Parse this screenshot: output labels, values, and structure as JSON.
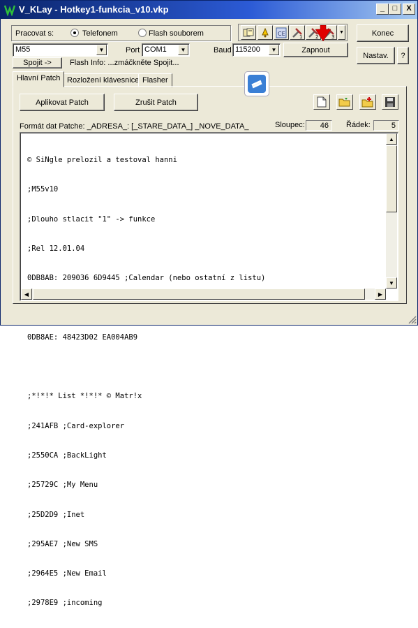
{
  "window": {
    "title": "V_KLay - Hotkey1-funkcia_v10.vkp",
    "minimize": "_",
    "maximize": "□",
    "close": "X"
  },
  "connection": {
    "pracovat_label": "Pracovat s:",
    "radio_phone": "Telefonem",
    "radio_flash": "Flash souborem",
    "radio_selected": "Telefonem",
    "model_value": "M55",
    "port_label": "Port",
    "port_value": "COM1",
    "baud_label": "Baud",
    "baud_value": "115200",
    "spojit_button": "Spojit ->",
    "flash_info": "Flash Info: ...zmáčkněte Spojit...",
    "zapnout_button": "Zapnout"
  },
  "toolbar_icons": [
    "phone-book-icon",
    "bell-icon",
    "ce-icon",
    "tools-1-icon",
    "tools-2-icon",
    "tools-3-icon",
    "dropdown-arrow-icon"
  ],
  "toolbar_numbers": [
    "1",
    "2",
    "3"
  ],
  "side_buttons": {
    "konec": "Konec",
    "nastav": "Nastav.",
    "help": "?"
  },
  "tabs": [
    {
      "label": "Hlavní Patch",
      "active": true
    },
    {
      "label": "Rozložení klávesnice",
      "active": false
    },
    {
      "label": "Flasher",
      "active": false
    }
  ],
  "patch": {
    "apply_button": "Aplikovat Patch",
    "cancel_button": "Zrušit Patch",
    "format_text": "Formát dat Patche: _ADRESA_: [_STARE_DATA_] _NOVE_DATA_",
    "sloupec_label": "Sloupec:",
    "sloupec_value": "46",
    "radek_label": "Řádek:",
    "radek_value": "5"
  },
  "editor_lines": [
    "© SiNgle prelozil a testoval hanni",
    ";M55v10",
    ";Dlouho stlacit \"1\" -> funkce",
    ";Rel 12.01.04",
    "0DB8AB: 209036 6D9445 ;Calendar (nebo ostatní z listu)",
    "",
    "0DB8AE: 48423D02 EA004AB9",
    "",
    ";*!*!* List *!*!* © Matr!x",
    ";241AFB ;Card-explorer",
    ";2550CA ;BackLight",
    ";25729C ;My Menu",
    ";25D2D9 ;Inet",
    ";295AE7 ;New SMS",
    ";2964E5 ;New Email",
    ";2978E9 ;incoming"
  ],
  "colors": {
    "title_start": "#0a246a",
    "title_end": "#a6caf0",
    "face": "#ece9d8",
    "logo_blue": "#3a7fd5",
    "arrow_red": "#e00000"
  }
}
